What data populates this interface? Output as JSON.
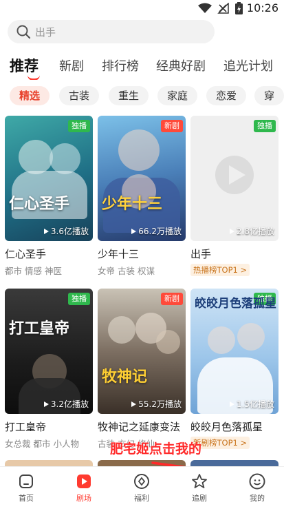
{
  "status_bar": {
    "time": "10:26"
  },
  "search": {
    "placeholder": "出手"
  },
  "top_tabs": [
    "推荐",
    "新剧",
    "排行榜",
    "经典好剧",
    "追光计划"
  ],
  "chips": [
    "精选",
    "古装",
    "重生",
    "家庭",
    "恋爱",
    "穿越"
  ],
  "cards": [
    {
      "title": "仁心圣手",
      "poster_title": "仁心圣手",
      "plays": "3.6亿播放",
      "tags": "都市 情感 神医",
      "badge": "独播",
      "badge_type": "exclusive",
      "rank": ""
    },
    {
      "title": "少年十三",
      "poster_title": "少年十三",
      "plays": "66.2万播放",
      "tags": "女帝 古装 权谋",
      "badge": "新剧",
      "badge_type": "new",
      "rank": ""
    },
    {
      "title": "出手",
      "poster_title": "",
      "plays": "2.8亿播放",
      "tags": "",
      "badge": "独播",
      "badge_type": "exclusive",
      "rank": "热播榜TOP1 >"
    },
    {
      "title": "打工皇帝",
      "poster_title": "打工皇帝",
      "plays": "3.2亿播放",
      "tags": "女总裁 都市 小人物",
      "badge": "独播",
      "badge_type": "exclusive",
      "rank": ""
    },
    {
      "title": "牧神记之延康变法",
      "poster_title": "牧神记",
      "plays": "55.2万播放",
      "tags": "古装 玄幻 修仙",
      "badge": "新剧",
      "badge_type": "new",
      "rank": ""
    },
    {
      "title": "皎皎月色落孤星",
      "poster_title": "皎皎月色落孤星",
      "plays": "1.5亿播放",
      "tags": "",
      "badge": "独播",
      "badge_type": "exclusive",
      "rank": "新剧榜TOP1 >"
    }
  ],
  "annotation": "肥宅姬点击我的",
  "bottom_nav": [
    "首页",
    "剧场",
    "福利",
    "追剧",
    "我的"
  ],
  "colors": {
    "accent": "#ff3b30",
    "exclusive_badge": "#2fb84d",
    "new_badge": "#ff4a3a",
    "rank_tag": "#c9751e"
  }
}
